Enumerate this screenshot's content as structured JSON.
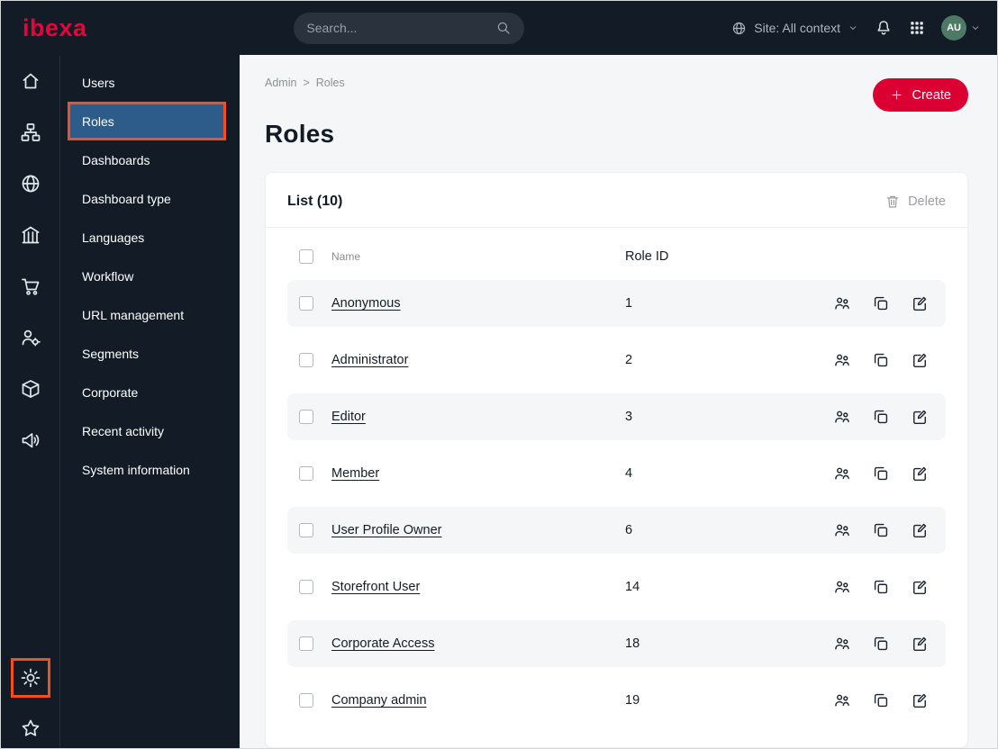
{
  "topbar": {
    "logo": "ibexa",
    "search": {
      "placeholder": "Search..."
    },
    "site_selector": {
      "label": "Site: All context"
    },
    "avatar": {
      "initials": "AU"
    }
  },
  "icon_rail": {
    "top_icons": [
      "home-icon",
      "sitemap-icon",
      "globe-icon",
      "company-icon",
      "cart-icon",
      "personalization-icon",
      "catalog-icon",
      "megaphone-icon"
    ],
    "bottom_icons": [
      "gear-icon",
      "star-icon"
    ]
  },
  "sidebar": {
    "items": [
      {
        "label": "Users"
      },
      {
        "label": "Roles",
        "selected": true
      },
      {
        "label": "Dashboards"
      },
      {
        "label": "Dashboard type"
      },
      {
        "label": "Languages"
      },
      {
        "label": "Workflow"
      },
      {
        "label": "URL management"
      },
      {
        "label": "Segments"
      },
      {
        "label": "Corporate"
      },
      {
        "label": "Recent activity"
      },
      {
        "label": "System information"
      }
    ]
  },
  "main": {
    "breadcrumb": {
      "items": [
        "Admin",
        "Roles"
      ],
      "separator": ">"
    },
    "create_button": "Create",
    "page_title": "Roles",
    "list_card": {
      "title": "List (10)",
      "delete_button": "Delete",
      "columns": {
        "name": "Name",
        "role_id": "Role ID"
      },
      "row_actions": [
        "assign-icon",
        "copy-icon",
        "edit-icon"
      ],
      "rows": [
        {
          "name": "Anonymous",
          "role_id": "1"
        },
        {
          "name": "Administrator",
          "role_id": "2"
        },
        {
          "name": "Editor",
          "role_id": "3"
        },
        {
          "name": "Member",
          "role_id": "4"
        },
        {
          "name": "User Profile Owner",
          "role_id": "6"
        },
        {
          "name": "Storefront User",
          "role_id": "14"
        },
        {
          "name": "Corporate Access",
          "role_id": "18"
        },
        {
          "name": "Company admin",
          "role_id": "19"
        }
      ]
    }
  },
  "colors": {
    "brand_red": "#dc0032",
    "dark_navy": "#131c26",
    "selected_blue": "#2e5c8a",
    "annotation_orange": "#f4501e"
  }
}
